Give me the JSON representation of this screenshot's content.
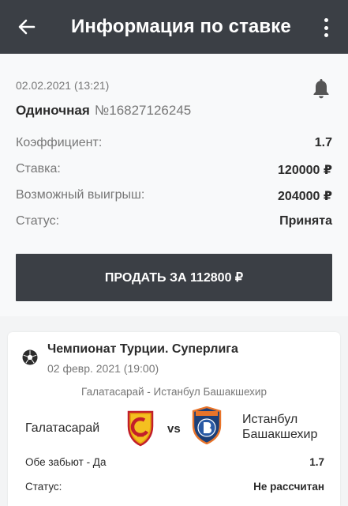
{
  "header": {
    "title": "Информация по ставке",
    "back_icon": "arrow-left-icon",
    "menu_icon": "more-vertical-icon"
  },
  "bet": {
    "datetime": "02.02.2021 (13:21)",
    "type": "Одиночная",
    "number": "№16827126245",
    "notify_icon": "bell-icon",
    "rows": [
      {
        "label": "Коэффициент:",
        "value": "1.7"
      },
      {
        "label": "Ставка:",
        "value": "120000 ₽"
      },
      {
        "label": "Возможный выигрыш:",
        "value": "204000 ₽"
      },
      {
        "label": "Статус:",
        "value": "Принята"
      }
    ],
    "sell_label": "ПРОДАТЬ ЗА 112800 ₽"
  },
  "event": {
    "sport_icon": "football-icon",
    "league": "Чемпионат Турции. Суперлига",
    "date": "02 февр. 2021 (19:00)",
    "match": "Галатасарай - Истанбул Башакшехир",
    "team1": "Галатасарай",
    "vs": "vs",
    "team2_line1": "Истанбул",
    "team2_line2": "Башакшехир",
    "outcome": "Обе забьют - Да",
    "odds": "1.7",
    "status_label": "Статус:",
    "status_value": "Не рассчитан"
  },
  "colors": {
    "header_bg": "#3b3f45",
    "button_bg": "#3b3f45",
    "page_bg": "#f3f4f5"
  }
}
